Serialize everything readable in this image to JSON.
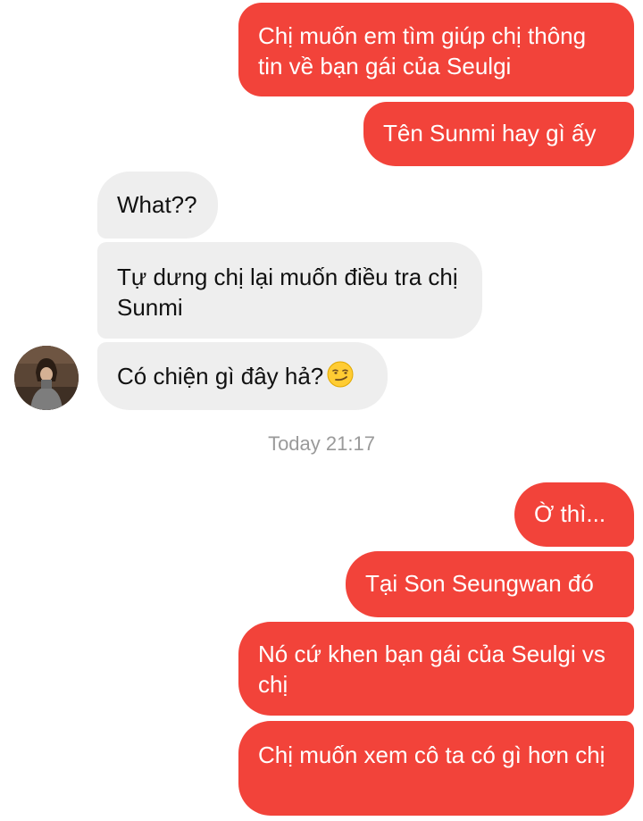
{
  "messages": {
    "m1": "Chị muốn em tìm giúp chị thông tin về bạn gái của Seulgi",
    "m2": "Tên Sunmi hay gì ấy",
    "m3": "What??",
    "m4": "Tự dưng chị lại muốn điều tra chị Sunmi",
    "m5": "Có chiện gì đây hả?",
    "m6": "Ờ thì...",
    "m7": "Tại Son Seungwan đó",
    "m8": "Nó cứ khen bạn gái của Seulgi vs chị",
    "m9": "Chị muốn xem cô ta có gì hơn chị"
  },
  "timestamp": "Today 21:17",
  "icons": {
    "smirk": "smirking-face-emoji",
    "avatar": "contact-avatar"
  },
  "colors": {
    "outgoing_bubble": "#f2433a",
    "incoming_bubble": "#eeeeee",
    "timestamp_text": "#9a9a9a"
  }
}
